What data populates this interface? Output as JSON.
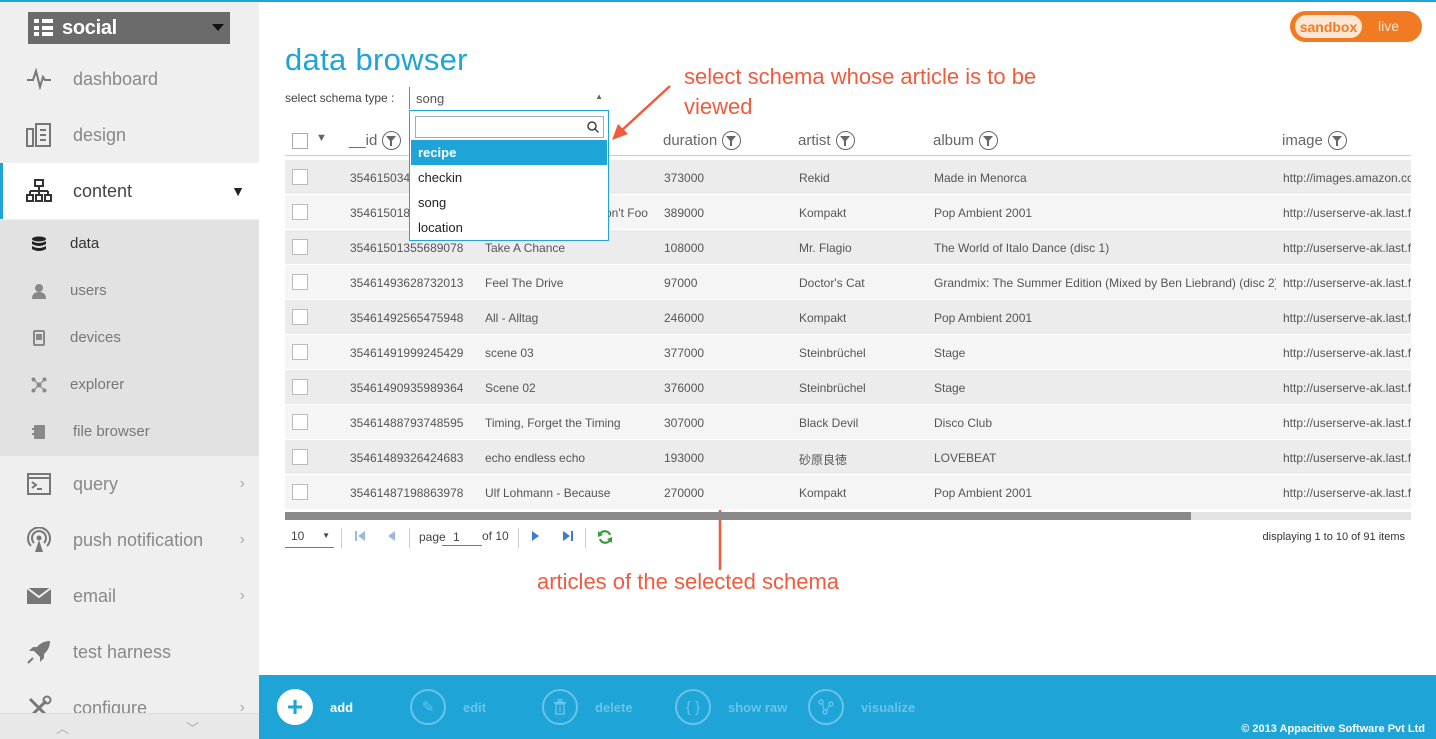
{
  "app": {
    "name": "social"
  },
  "env": {
    "sandbox": "sandbox",
    "live": "live"
  },
  "sidebar": {
    "items": [
      {
        "label": "dashboard",
        "icon": "pulse-icon"
      },
      {
        "label": "design",
        "icon": "design-icon"
      },
      {
        "label": "content",
        "icon": "sitemap-icon"
      },
      {
        "label": "query",
        "icon": "terminal-icon"
      },
      {
        "label": "push notification",
        "icon": "broadcast-icon"
      },
      {
        "label": "email",
        "icon": "envelope-icon"
      },
      {
        "label": "test harness",
        "icon": "rocket-icon"
      },
      {
        "label": "configure",
        "icon": "tools-icon"
      }
    ],
    "subitems": [
      {
        "label": "data",
        "icon": "database-icon"
      },
      {
        "label": "users",
        "icon": "user-icon"
      },
      {
        "label": "devices",
        "icon": "device-icon"
      },
      {
        "label": "explorer",
        "icon": "graph-icon"
      },
      {
        "label": "file browser",
        "icon": "file-icon"
      }
    ]
  },
  "main": {
    "title": "data browser",
    "schema_label": "select schema type :",
    "schema_value": "song",
    "dropdown_options": [
      "recipe",
      "checkin",
      "song",
      "location"
    ]
  },
  "annotations": {
    "top": "select schema whose article is to be viewed",
    "bottom": "articles of the selected schema"
  },
  "table": {
    "columns": [
      "__id",
      "duration",
      "artist",
      "album",
      "image"
    ],
    "rows": [
      {
        "id": "354615034",
        "title": "",
        "duration": "373000",
        "artist": "Rekid",
        "album": "Made in Menorca",
        "image": "http://images.amazon.co"
      },
      {
        "id": "354615018",
        "title": "on't Foo",
        "duration": "389000",
        "artist": "Kompakt",
        "album": "Pop Ambient 2001",
        "image": "http://userserve-ak.last.f"
      },
      {
        "id": "35461501355689078",
        "title": "Take A Chance",
        "duration": "108000",
        "artist": "Mr. Flagio",
        "album": "The World of Italo Dance (disc 1)",
        "image": "http://userserve-ak.last.f"
      },
      {
        "id": "35461493628732013",
        "title": "Feel The Drive",
        "duration": "97000",
        "artist": "Doctor's Cat",
        "album": "Grandmix: The Summer Edition (Mixed by Ben Liebrand) (disc 2)",
        "image": "http://userserve-ak.last.f"
      },
      {
        "id": "35461492565475948",
        "title": "All - Alltag",
        "duration": "246000",
        "artist": "Kompakt",
        "album": "Pop Ambient 2001",
        "image": "http://userserve-ak.last.f"
      },
      {
        "id": "35461491999245429",
        "title": "scene 03",
        "duration": "377000",
        "artist": "Steinbrüchel",
        "album": "Stage",
        "image": "http://userserve-ak.last.f"
      },
      {
        "id": "35461490935989364",
        "title": "Scene 02",
        "duration": "376000",
        "artist": "Steinbrüchel",
        "album": "Stage",
        "image": "http://userserve-ak.last.f"
      },
      {
        "id": "35461488793748595",
        "title": "Timing, Forget the Timing",
        "duration": "307000",
        "artist": "Black Devil",
        "album": "Disco Club",
        "image": "http://userserve-ak.last.f"
      },
      {
        "id": "35461489326424683",
        "title": "echo endless echo",
        "duration": "193000",
        "artist": "砂原良徳",
        "album": "LOVEBEAT",
        "image": "http://userserve-ak.last.f"
      },
      {
        "id": "35461487198863978",
        "title": "Ulf Lohmann - Because",
        "duration": "270000",
        "artist": "Kompakt",
        "album": "Pop Ambient 2001",
        "image": "http://userserve-ak.last.f"
      }
    ]
  },
  "pager": {
    "page_size": "10",
    "page_label": "page",
    "page": "1",
    "of_label": "of 10",
    "display": "displaying 1 to 10 of 91 items"
  },
  "footer": {
    "buttons": [
      "add",
      "edit",
      "delete",
      "show raw",
      "visualize"
    ],
    "copyright": "© 2013 Appacitive Software Pvt Ltd"
  },
  "colors": {
    "accent": "#1ea4d7",
    "annotation": "#f25a3e",
    "env": "#f07b22"
  }
}
